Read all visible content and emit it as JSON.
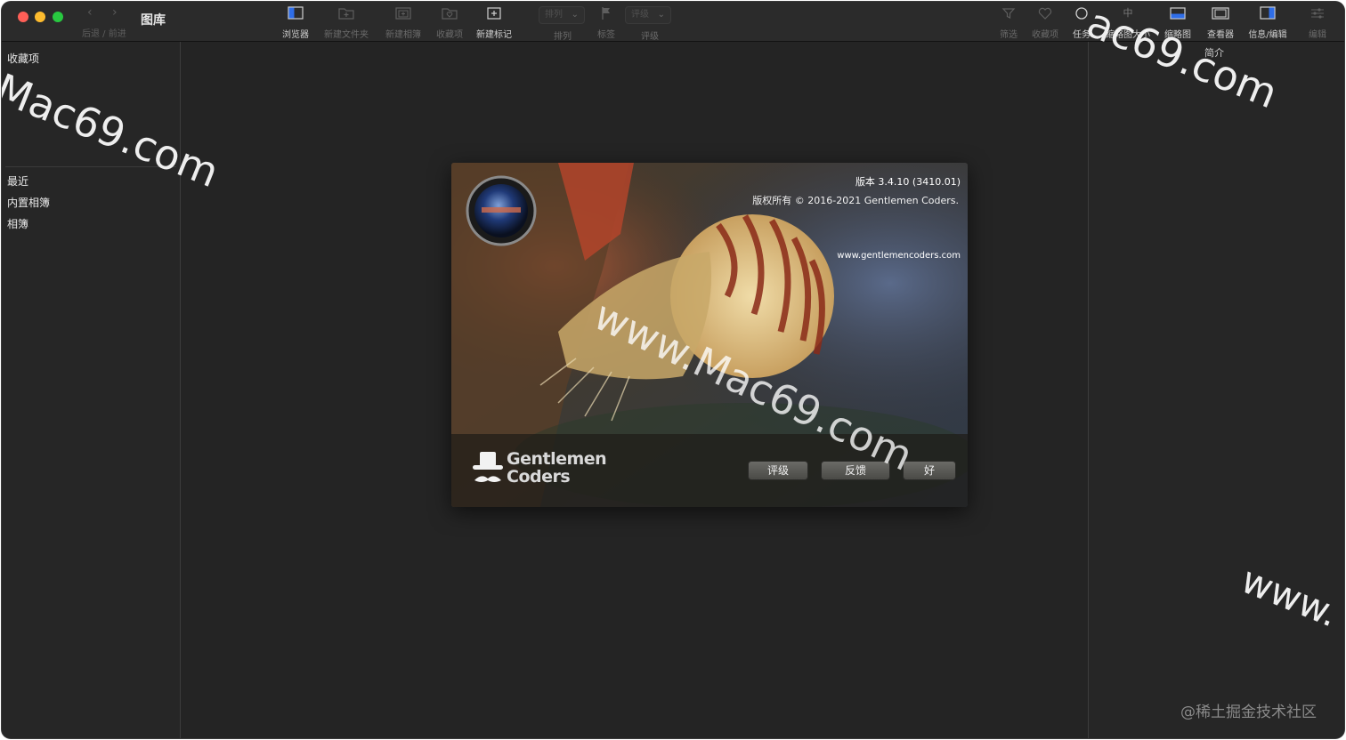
{
  "window": {
    "title": "图库",
    "nav_label": "后退 / 前进"
  },
  "toolbar": {
    "items": [
      {
        "label": "浏览器",
        "icon": "browser-icon",
        "active": true
      },
      {
        "label": "新建文件夹",
        "icon": "new-folder-icon",
        "active": false
      },
      {
        "label": "新建相簿",
        "icon": "new-album-icon",
        "active": false
      },
      {
        "label": "收藏项",
        "icon": "favorites-icon",
        "active": false
      },
      {
        "label": "新建标记",
        "icon": "new-tag-icon",
        "active": true
      },
      {
        "label": "排列",
        "icon": "sort-icon",
        "active": false
      },
      {
        "label": "标签",
        "icon": "flag-icon",
        "active": false
      },
      {
        "label": "评级",
        "icon": "rating-icon",
        "active": false
      },
      {
        "label": "筛选",
        "icon": "filter-icon",
        "active": false
      },
      {
        "label": "收藏项",
        "icon": "heart-icon",
        "active": false
      },
      {
        "label": "任务",
        "icon": "task-icon",
        "active": true
      },
      {
        "label": "缩略图大小",
        "icon": "thumbnail-size-icon",
        "active": true
      },
      {
        "label": "缩略图",
        "icon": "thumbnail-icon",
        "active": true
      },
      {
        "label": "查看器",
        "icon": "viewer-icon",
        "active": true
      },
      {
        "label": "信息/编辑",
        "icon": "info-edit-icon",
        "active": true
      },
      {
        "label": "编辑",
        "icon": "adjust-icon",
        "active": false
      }
    ],
    "sort_dropdown": "排列",
    "rating_dropdown": "评级",
    "overflow_label": "简介",
    "partial_label": "中"
  },
  "sidebar": {
    "favorites_header": "收藏项",
    "items": [
      {
        "label": "最近"
      },
      {
        "label": "内置相簿"
      },
      {
        "label": "相簿"
      }
    ]
  },
  "about": {
    "version": "版本 3.4.10 (3410.01)",
    "copyright": "版权所有 © 2016-2021 Gentlemen Coders.",
    "website": "www.gentlemencoders.com",
    "logo_line1": "Gentlemen",
    "logo_line2": "Coders",
    "buttons": {
      "rate": "评级",
      "feedback": "反馈",
      "ok": "好"
    }
  },
  "watermarks": {
    "top_left": "Mac69.com",
    "center": "www.Mac69.com",
    "top_right": "ac69.com",
    "bottom_right": "www."
  },
  "footer_credit": "@稀土掘金技术社区",
  "colors": {
    "window_bg": "#242424",
    "toolbar_bg": "#2b2b2b",
    "accent_blue": "#2f6ee8",
    "close": "#fe5f57",
    "minimize": "#febc2e",
    "zoom": "#28c840"
  }
}
